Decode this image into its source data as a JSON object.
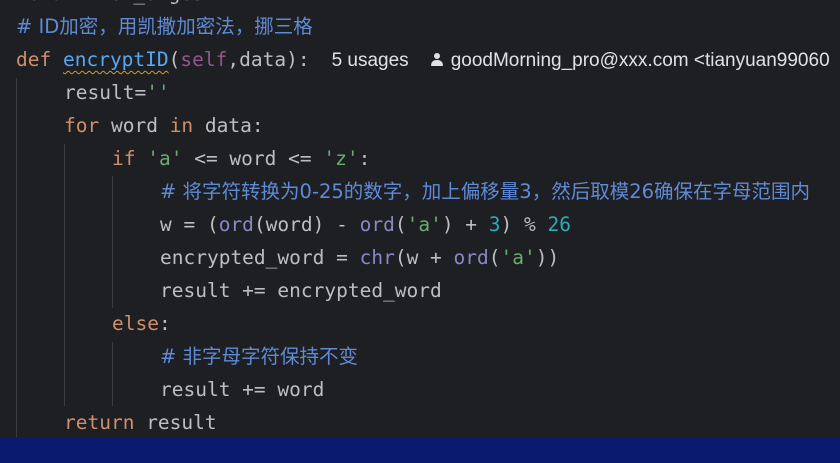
{
  "editor": {
    "language": "Python",
    "line_prev": "    return hex_digest",
    "comment_header": "# ID加密，用凯撒加密法，挪三格",
    "def_kw": "def",
    "func_name": "encryptID",
    "params_open": "(",
    "self_kw": "self",
    "params_rest": ",data):",
    "usages_hint": "5 usages",
    "author_hint": "goodMorning_pro@xxx.com <tianyuan99060",
    "line_result_init": "result=",
    "empty_str": "''",
    "for_kw": "for",
    "loop_var": " word ",
    "in_kw": "in",
    "loop_iter": " data:",
    "if_kw": "if",
    "str_a": "'a'",
    "cmp1": " <= word <= ",
    "str_z": "'z'",
    "colon": ":",
    "comment_shift": "# 将字符转换为0-25的数字，加上偏移量3，然后取模26确保在字母范围内",
    "w_assign_1": "w = (",
    "ord_fn": "ord",
    "w_assign_2": "(word) - ",
    "paren_open": "(",
    "w_assign_3": ") + ",
    "num_3": "3",
    "w_assign_4": ") % ",
    "num_26": "26",
    "enc_assign": "encrypted_word = ",
    "chr_fn": "chr",
    "enc_mid": "(w + ",
    "enc_close": "))",
    "result_add_enc": "result += encrypted_word",
    "else_kw": "else",
    "comment_nonalpha": "# 非字母字符保持不变",
    "result_add_word": "result += word",
    "return_kw": "return",
    "return_val": " result"
  },
  "colors": {
    "background": "#1e1f22",
    "keyword": "#cf8e6d",
    "string": "#6aab73",
    "number": "#2aacb8",
    "comment": "#7a7e85",
    "status_bar": "#0a1a6e"
  }
}
